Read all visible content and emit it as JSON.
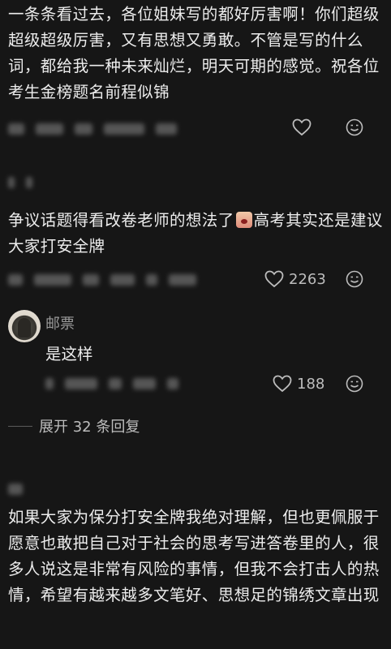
{
  "comments": [
    {
      "text": "一条条看过去，各位姐妹写的都好厉害啊！你们超级超级超级厉害，又有思想又勇敢。不管是写的什么词，都给我一种未来灿烂，明天可期的感觉。祝各位考生金榜题名前程似锦",
      "like_count": "",
      "like_icon": "heart-outline-icon",
      "reply_icon": "emoji-face-icon"
    },
    {
      "text_before_emoji": "争议话题得看改卷老师的想法了",
      "emoji": "crying-face-emoji",
      "text_after_emoji": "高考其实还是建议大家打安全牌",
      "like_count": "2263",
      "like_icon": "heart-outline-icon",
      "reply_icon": "emoji-face-icon"
    },
    {
      "text": "如果大家为保分打安全牌我绝对理解，但也更佩服于愿意也敢把自己对于社会的思考写进答卷里的人，很多人说这是非常有风险的事情，但我不会打击人的热情，希望有越来越多文笔好、思想足的锦绣文章出现"
    }
  ],
  "reply": {
    "username": "邮票",
    "text": "是这样",
    "like_count": "188"
  },
  "expand_replies": {
    "label": "展开 32 条回复"
  }
}
